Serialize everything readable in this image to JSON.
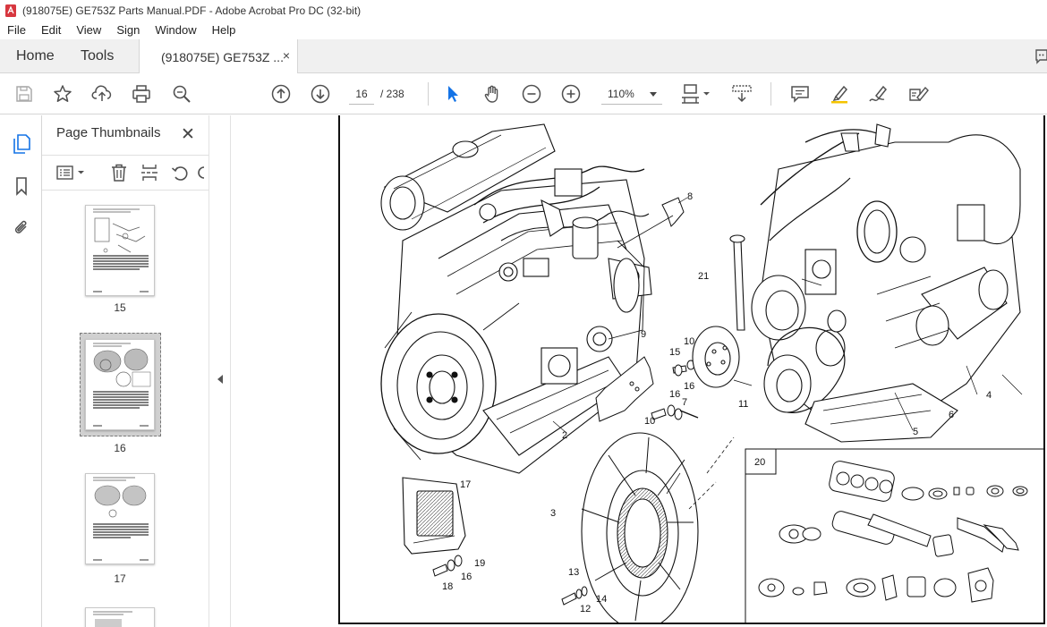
{
  "window": {
    "title": "(918075E) GE753Z Parts Manual.PDF - Adobe Acrobat Pro DC (32-bit)"
  },
  "menu": {
    "items": [
      "File",
      "Edit",
      "View",
      "Sign",
      "Window",
      "Help"
    ]
  },
  "tabs": {
    "home": "Home",
    "tools": "Tools",
    "document": "(918075E) GE753Z ...",
    "close_glyph": "×"
  },
  "toolbar": {
    "current_page": "16",
    "total_pages": "/ 238",
    "zoom": "110%",
    "icons": [
      "save-icon",
      "bookmark-star-icon",
      "upload-icon",
      "print-icon",
      "search-zoom-icon",
      "page-up-icon",
      "page-down-icon",
      "select-cursor-icon",
      "hand-icon",
      "zoom-out-icon",
      "zoom-in-icon",
      "page-fit-icon",
      "scroll-mode-icon",
      "comment-icon",
      "highlight-icon",
      "draw-icon",
      "fill-sign-icon"
    ]
  },
  "sidebar": {
    "rail_icons": [
      "page-thumbnails-icon",
      "bookmarks-icon",
      "attachments-icon"
    ],
    "panel_title": "Page Thumbnails",
    "close_glyph": "✕",
    "thumbnails": [
      {
        "page": "15"
      },
      {
        "page": "16",
        "selected": true
      },
      {
        "page": "17"
      }
    ]
  },
  "diagram": {
    "callouts": [
      "2",
      "3",
      "4",
      "5",
      "6",
      "8",
      "9",
      "10",
      "10",
      "11",
      "12",
      "13",
      "14",
      "15",
      "16",
      "16",
      "16",
      "17",
      "18",
      "19",
      "20",
      "21",
      "7"
    ],
    "inset_label": "20"
  },
  "colors": {
    "accent_blue": "#1473e6",
    "acrobat_red": "#d7373f",
    "tab_bg": "#f0f0f0",
    "icon_gray": "#505050"
  }
}
